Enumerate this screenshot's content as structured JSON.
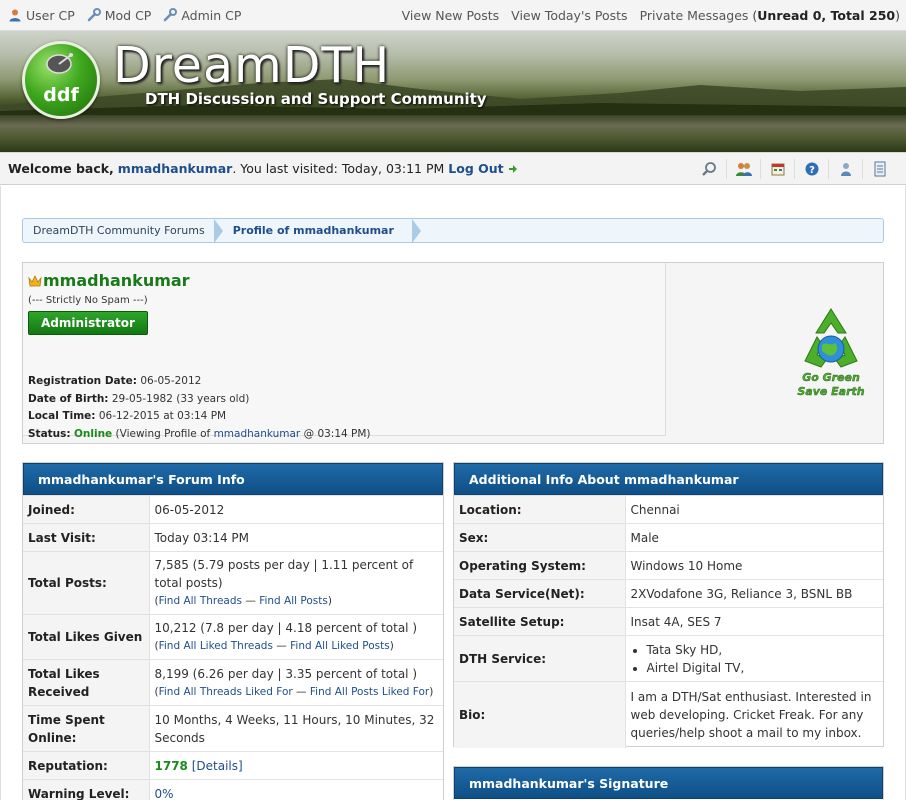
{
  "topbar": {
    "user_cp": "User CP",
    "mod_cp": "Mod CP",
    "admin_cp": "Admin CP",
    "view_new_posts": "View New Posts",
    "view_todays_posts": "View Today's Posts",
    "private_messages": "Private Messages",
    "pm_open": " (",
    "pm_counts": "Unread 0, Total 250",
    "pm_close": ")"
  },
  "banner": {
    "logo_text": "ddf",
    "brand": "DreamDTH",
    "tagline": "DTH Discussion and Support Community"
  },
  "welcome": {
    "prefix": "Welcome back,",
    "username": "mmadhankumar",
    "last_visited": ". You last visited: Today, 03:11 PM",
    "logout": "Log Out"
  },
  "breadcrumb": {
    "home": "DreamDTH Community Forums",
    "current": "Profile of mmadhankumar"
  },
  "profile": {
    "name": "mmadhankumar",
    "user_title": "(--- Strictly No Spam ---)",
    "rank_button": "Administrator",
    "reg_label": "Registration Date:",
    "reg_value": "06-05-2012",
    "dob_label": "Date of Birth:",
    "dob_value": "29-05-1982 (33 years old)",
    "local_label": "Local Time:",
    "local_value": "06-12-2015 at 03:14 PM",
    "status_label": "Status:",
    "status_value": "Online",
    "status_detail_pre": "(Viewing Profile of ",
    "status_link": "mmadhankumar",
    "status_detail_post": " @ 03:14 PM)",
    "go_green_line1": "Go Green",
    "go_green_line2": "Save Earth"
  },
  "forum_info": {
    "title": "mmadhankumar's Forum Info",
    "joined_label": "Joined:",
    "joined_value": "06-05-2012",
    "last_visit_label": "Last Visit:",
    "last_visit_value": "Today 03:14 PM",
    "total_posts_label": "Total Posts:",
    "total_posts_value": "7,585 (5.79 posts per day | 1.11 percent of total posts)",
    "find_all_threads": "Find All Threads",
    "find_all_posts": "Find All Posts",
    "likes_given_label": "Total Likes Given",
    "likes_given_value": "10,212 (7.8 per day | 4.18 percent of total )",
    "find_all_liked_threads": "Find All Liked Threads",
    "find_all_liked_posts": "Find All Liked Posts",
    "likes_received_label": "Total Likes Received",
    "likes_received_value": "8,199 (6.26 per day | 3.35 percent of total )",
    "find_threads_liked_for": "Find All Threads Liked For",
    "find_posts_liked_for": "Find All Posts Liked For",
    "time_online_label": "Time Spent Online:",
    "time_online_value": "10 Months, 4 Weeks, 11 Hours, 10 Minutes, 32 Seconds",
    "reputation_label": "Reputation:",
    "reputation_value": "1778",
    "reputation_details": "[Details]",
    "warning_label": "Warning Level:",
    "warning_value": "0%",
    "sep": " — "
  },
  "additional_info": {
    "title": "Additional Info About mmadhankumar",
    "location_label": "Location:",
    "location_value": "Chennai",
    "sex_label": "Sex:",
    "sex_value": "Male",
    "os_label": "Operating System:",
    "os_value": "Windows 10 Home",
    "data_label": "Data Service(Net):",
    "data_value": "2XVodafone 3G, Reliance 3, BSNL BB",
    "sat_label": "Satellite Setup:",
    "sat_value": "Insat 4A, SES 7",
    "dth_label": "DTH Service:",
    "dth_items": [
      "Tata Sky HD,",
      "Airtel Digital TV,"
    ],
    "bio_label": "Bio:",
    "bio_value": "I am a DTH/Sat enthusiast. Interested in web developing. Cricket Freak. For any queries/help shoot a mail to my inbox."
  },
  "signature": {
    "title": "mmadhankumar's Signature"
  },
  "colors": {
    "header_blue": "#1f6aa8",
    "online_green": "#1a8a1a",
    "link_blue": "#1f4e8c"
  }
}
